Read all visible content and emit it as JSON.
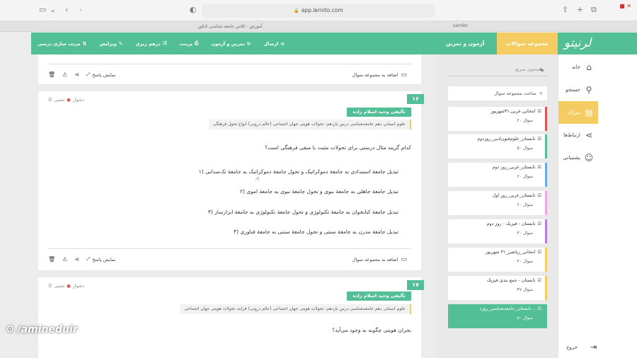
{
  "browser": {
    "url": "app.lernito.com",
    "tab_title": "آموزش - کلاس جامعه شناسی کنکور",
    "tab2_title": "Lernito"
  },
  "header": {
    "logo": "لرنیتو",
    "tab_collections": "مجموعه سوالات",
    "tab_exam": "آزمون و تمرین",
    "actions": [
      "ارسال",
      "تمرین و آزمون",
      "پرینت",
      "درهم ریزی",
      "ویرایش",
      "مرتب سازی درسی"
    ]
  },
  "nav": {
    "items": [
      {
        "label": "خانه",
        "icon": "home-icon"
      },
      {
        "label": "جستجو",
        "icon": "search-icon"
      },
      {
        "label": "میزکار",
        "icon": "document-icon"
      },
      {
        "label": "ارتباط‌ها",
        "icon": "share-icon"
      },
      {
        "label": "پشتیبانی",
        "icon": "support-icon"
      }
    ],
    "logout": "خروج"
  },
  "sidebar": {
    "search_placeholder": "جستجوی سریع",
    "new_collection": "ساخت مجموعه سوال",
    "collections": [
      {
        "title": "انتخابی.عربی.۳۱شهریور",
        "count": "۲۰ سوال",
        "color": "#e25555"
      },
      {
        "title": "تابستان_علوم‌فنون‌ادبی_روزدوم",
        "count": "۵۰ سوال",
        "color": "#53bf97"
      },
      {
        "title": "تابستان_عربی_روز دوم",
        "count": "۶۰ سوال",
        "color": "#6aa8e8"
      },
      {
        "title": "تابستان_عربی_روز اول",
        "count": "۶۰ سوال",
        "color": "#f0a8e0"
      },
      {
        "title": "تابستان - فیزیک - روز دوم",
        "count": "۳۰ سوال",
        "color": "#b57be0"
      },
      {
        "title": "انتخابی_ریاضی_۳۱ شهریور",
        "count": "۲۰ سوال",
        "color": "#f5cc62"
      },
      {
        "title": "تابستان - جمع بندی فیزیک",
        "count": "۴۷ سوال",
        "color": "#f5cc62"
      },
      {
        "title": "تابستان_جامعه‌شناسی_روزد...",
        "count": "۵۰ سوال",
        "color": "#53bf97"
      }
    ]
  },
  "footer_labels": {
    "add_to_collection": "اضافه به مجموعه سوال",
    "show_answer": "نمایش پاسخ"
  },
  "questions": [
    {
      "number": "۱۶",
      "difficulty": "دشوار",
      "type": "تستی",
      "author": "تألیفی   وحید اسلام زاده",
      "tags": "علوم انسانی  دهم  جامعه‌شناسی  درس یازدهم: تحولات هویتی جهان اجتماعی (عالم درونی)  انواع تحول فرهنگی",
      "text": "کدام گزینه مثال درستی برای تحولات مثبت یا منفی فرهنگی است؟",
      "options": [
        "۱)  تبدیل جامعهٔ استبدادی به جامعهٔ دموکراتیک و تحول جامعهٔ دموکراتیک به جامعهٔ تک‌صدایی",
        "۲)  تبدیل جامعهٔ جاهلی به جامعهٔ نبوی و تحول جامعهٔ نبوی به جامعهٔ اموی",
        "۳)  تبدیل جامعهٔ کتابخوان به جامعهٔ تکنولوژی و تحول جامعهٔ تکنولوژی به جامعهٔ ابزارساز",
        "۴)  تبدیل جامعهٔ مدرن به جامعهٔ سنتی و تحول جامعهٔ سنتی به جامعهٔ فناوری"
      ]
    },
    {
      "number": "۱۷",
      "difficulty": "دشوار",
      "type": "تستی",
      "author": "تألیفی   وحید اسلام زاده",
      "tags": "علوم انسانی  دهم  جامعه‌شناسی  درس یازدهم: تحولات هویتی جهان اجتماعی (عالم درونی)  فرایند تحولات هویتی جهان اجتماعی",
      "text": "بحران هویتی چگونه به وجود می‌آید؟"
    }
  ],
  "watermark": "/amineduir"
}
